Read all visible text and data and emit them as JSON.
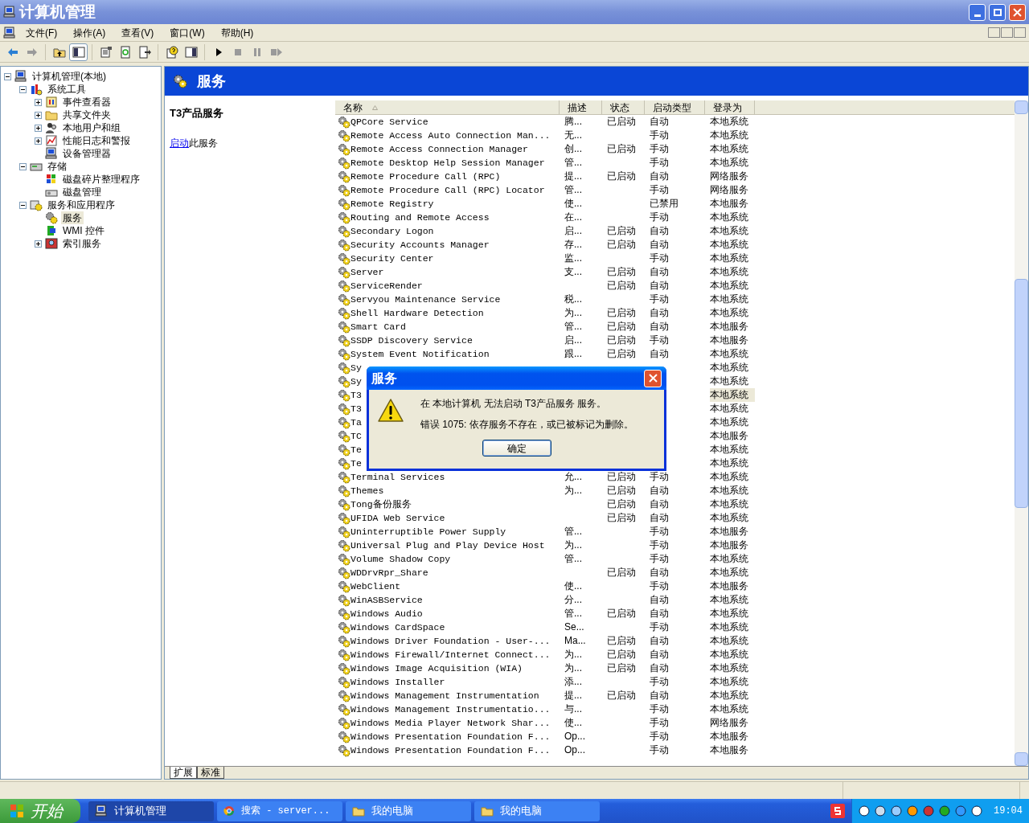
{
  "window": {
    "title": "计算机管理"
  },
  "menu": [
    "文件(F)",
    "操作(A)",
    "查看(V)",
    "窗口(W)",
    "帮助(H)"
  ],
  "toolbar": [
    {
      "kind": "back",
      "pressed": false
    },
    {
      "kind": "forward",
      "pressed": false
    },
    {
      "kind": "up",
      "pressed": false
    },
    {
      "kind": "tree",
      "pressed": true
    },
    {
      "kind": "properties",
      "pressed": false
    },
    {
      "kind": "refresh",
      "pressed": false
    },
    {
      "kind": "export",
      "pressed": false
    },
    {
      "kind": "help",
      "pressed": false
    },
    {
      "kind": "pane",
      "pressed": false
    },
    {
      "kind": "play",
      "pressed": false
    },
    {
      "kind": "stop",
      "pressed": false
    },
    {
      "kind": "pause",
      "pressed": false
    },
    {
      "kind": "restart",
      "pressed": false
    }
  ],
  "tree": [
    {
      "label": "计算机管理(本地)",
      "expanded": true,
      "selected": false,
      "children": [
        {
          "label": "系统工具",
          "expanded": true,
          "selected": false,
          "children": [
            {
              "label": "事件查看器",
              "expanded": false,
              "selected": false
            },
            {
              "label": "共享文件夹",
              "expanded": false,
              "selected": false
            },
            {
              "label": "本地用户和组",
              "expanded": false,
              "selected": false
            },
            {
              "label": "性能日志和警报",
              "expanded": false,
              "selected": false
            },
            {
              "label": "设备管理器",
              "selected": false
            }
          ]
        },
        {
          "label": "存储",
          "expanded": true,
          "selected": false,
          "children": [
            {
              "label": "磁盘碎片整理程序",
              "selected": false
            },
            {
              "label": "磁盘管理",
              "selected": false
            }
          ]
        },
        {
          "label": "服务和应用程序",
          "expanded": true,
          "selected": false,
          "children": [
            {
              "label": "服务",
              "selected": true
            },
            {
              "label": "WMI 控件",
              "selected": false
            },
            {
              "label": "索引服务",
              "expanded": false,
              "selected": false
            }
          ]
        }
      ]
    }
  ],
  "header": {
    "title": "服务"
  },
  "details": {
    "title": "T3产品服务",
    "link": "启动",
    "text": "此服务"
  },
  "table": {
    "columns": [
      {
        "label": "名称",
        "sorted": true
      },
      {
        "label": "描述",
        "sorted": false
      },
      {
        "label": "状态",
        "sorted": false
      },
      {
        "label": "启动类型",
        "sorted": false
      },
      {
        "label": "登录为",
        "sorted": false
      }
    ],
    "rows": [
      {
        "name": "QPCore Service",
        "description": "腾...",
        "status": "已启动",
        "startup_type": "自动",
        "log_on_as": "本地系统",
        "selected": false
      },
      {
        "name": "Remote Access Auto Connection Man...",
        "description": "无...",
        "status": "",
        "startup_type": "手动",
        "log_on_as": "本地系统",
        "selected": false
      },
      {
        "name": "Remote Access Connection Manager",
        "description": "创...",
        "status": "已启动",
        "startup_type": "手动",
        "log_on_as": "本地系统",
        "selected": false
      },
      {
        "name": "Remote Desktop Help Session Manager",
        "description": "管...",
        "status": "",
        "startup_type": "手动",
        "log_on_as": "本地系统",
        "selected": false
      },
      {
        "name": "Remote Procedure Call (RPC)",
        "description": "提...",
        "status": "已启动",
        "startup_type": "自动",
        "log_on_as": "网络服务",
        "selected": false
      },
      {
        "name": "Remote Procedure Call (RPC) Locator",
        "description": "管...",
        "status": "",
        "startup_type": "手动",
        "log_on_as": "网络服务",
        "selected": false
      },
      {
        "name": "Remote Registry",
        "description": "使...",
        "status": "",
        "startup_type": "已禁用",
        "log_on_as": "本地服务",
        "selected": false
      },
      {
        "name": "Routing and Remote Access",
        "description": "在...",
        "status": "",
        "startup_type": "手动",
        "log_on_as": "本地系统",
        "selected": false
      },
      {
        "name": "Secondary Logon",
        "description": "启...",
        "status": "已启动",
        "startup_type": "自动",
        "log_on_as": "本地系统",
        "selected": false
      },
      {
        "name": "Security Accounts Manager",
        "description": "存...",
        "status": "已启动",
        "startup_type": "自动",
        "log_on_as": "本地系统",
        "selected": false
      },
      {
        "name": "Security Center",
        "description": "监...",
        "status": "",
        "startup_type": "手动",
        "log_on_as": "本地系统",
        "selected": false
      },
      {
        "name": "Server",
        "description": "支...",
        "status": "已启动",
        "startup_type": "自动",
        "log_on_as": "本地系统",
        "selected": false
      },
      {
        "name": "ServiceRender",
        "description": "",
        "status": "已启动",
        "startup_type": "自动",
        "log_on_as": "本地系统",
        "selected": false
      },
      {
        "name": "Servyou Maintenance Service",
        "description": "税...",
        "status": "",
        "startup_type": "手动",
        "log_on_as": "本地系统",
        "selected": false
      },
      {
        "name": "Shell Hardware Detection",
        "description": "为...",
        "status": "已启动",
        "startup_type": "自动",
        "log_on_as": "本地系统",
        "selected": false
      },
      {
        "name": "Smart Card",
        "description": "管...",
        "status": "已启动",
        "startup_type": "自动",
        "log_on_as": "本地服务",
        "selected": false
      },
      {
        "name": "SSDP Discovery Service",
        "description": "启...",
        "status": "已启动",
        "startup_type": "手动",
        "log_on_as": "本地服务",
        "selected": false
      },
      {
        "name": "System Event Notification",
        "description": "跟...",
        "status": "已启动",
        "startup_type": "自动",
        "log_on_as": "本地系统",
        "selected": false
      },
      {
        "name": "Sy",
        "description": "",
        "status": "",
        "startup_type": "",
        "log_on_as": "本地系统",
        "selected": false
      },
      {
        "name": "Sy",
        "description": "",
        "status": "",
        "startup_type": "",
        "log_on_as": "本地系统",
        "selected": false
      },
      {
        "name": "T3",
        "description": "",
        "status": "",
        "startup_type": "",
        "log_on_as": "本地系统",
        "selected": true
      },
      {
        "name": "T3",
        "description": "",
        "status": "",
        "startup_type": "",
        "log_on_as": "本地系统",
        "selected": false
      },
      {
        "name": "Ta",
        "description": "",
        "status": "",
        "startup_type": "",
        "log_on_as": "本地系统",
        "selected": false
      },
      {
        "name": "TC",
        "description": "",
        "status": "",
        "startup_type": "",
        "log_on_as": "本地服务",
        "selected": false
      },
      {
        "name": "Te",
        "description": "",
        "status": "",
        "startup_type": "",
        "log_on_as": "本地系统",
        "selected": false
      },
      {
        "name": "Te",
        "description": "",
        "status": "",
        "startup_type": "",
        "log_on_as": "本地系统",
        "selected": false
      },
      {
        "name": "Terminal Services",
        "description": "允...",
        "status": "已启动",
        "startup_type": "手动",
        "log_on_as": "本地系统",
        "selected": false
      },
      {
        "name": "Themes",
        "description": "为...",
        "status": "已启动",
        "startup_type": "自动",
        "log_on_as": "本地系统",
        "selected": false
      },
      {
        "name": "Tong备份服务",
        "description": "",
        "status": "已启动",
        "startup_type": "自动",
        "log_on_as": "本地系统",
        "selected": false
      },
      {
        "name": "UFIDA Web Service",
        "description": "",
        "status": "已启动",
        "startup_type": "自动",
        "log_on_as": "本地系统",
        "selected": false
      },
      {
        "name": "Uninterruptible Power Supply",
        "description": "管...",
        "status": "",
        "startup_type": "手动",
        "log_on_as": "本地服务",
        "selected": false
      },
      {
        "name": "Universal Plug and Play Device Host",
        "description": "为...",
        "status": "",
        "startup_type": "手动",
        "log_on_as": "本地服务",
        "selected": false
      },
      {
        "name": "Volume Shadow Copy",
        "description": "管...",
        "status": "",
        "startup_type": "手动",
        "log_on_as": "本地系统",
        "selected": false
      },
      {
        "name": "WDDrvRpr_Share",
        "description": "",
        "status": "已启动",
        "startup_type": "自动",
        "log_on_as": "本地系统",
        "selected": false
      },
      {
        "name": "WebClient",
        "description": "使...",
        "status": "",
        "startup_type": "手动",
        "log_on_as": "本地服务",
        "selected": false
      },
      {
        "name": "WinASBService",
        "description": "分...",
        "status": "",
        "startup_type": "自动",
        "log_on_as": "本地系统",
        "selected": false
      },
      {
        "name": "Windows Audio",
        "description": "管...",
        "status": "已启动",
        "startup_type": "自动",
        "log_on_as": "本地系统",
        "selected": false
      },
      {
        "name": "Windows CardSpace",
        "description": "Se...",
        "status": "",
        "startup_type": "手动",
        "log_on_as": "本地系统",
        "selected": false
      },
      {
        "name": "Windows Driver Foundation - User-...",
        "description": "Ma...",
        "status": "已启动",
        "startup_type": "自动",
        "log_on_as": "本地系统",
        "selected": false
      },
      {
        "name": "Windows Firewall/Internet Connect...",
        "description": "为...",
        "status": "已启动",
        "startup_type": "自动",
        "log_on_as": "本地系统",
        "selected": false
      },
      {
        "name": "Windows Image Acquisition (WIA)",
        "description": "为...",
        "status": "已启动",
        "startup_type": "自动",
        "log_on_as": "本地系统",
        "selected": false
      },
      {
        "name": "Windows Installer",
        "description": "添...",
        "status": "",
        "startup_type": "手动",
        "log_on_as": "本地系统",
        "selected": false
      },
      {
        "name": "Windows Management Instrumentation",
        "description": "提...",
        "status": "已启动",
        "startup_type": "自动",
        "log_on_as": "本地系统",
        "selected": false
      },
      {
        "name": "Windows Management Instrumentatio...",
        "description": "与...",
        "status": "",
        "startup_type": "手动",
        "log_on_as": "本地系统",
        "selected": false
      },
      {
        "name": "Windows Media Player Network Shar...",
        "description": "使...",
        "status": "",
        "startup_type": "手动",
        "log_on_as": "网络服务",
        "selected": false
      },
      {
        "name": "Windows Presentation Foundation F...",
        "description": "Op...",
        "status": "",
        "startup_type": "手动",
        "log_on_as": "本地服务",
        "selected": false
      },
      {
        "name": "Windows Presentation Foundation F...",
        "description": "Op...",
        "status": "",
        "startup_type": "手动",
        "log_on_as": "本地服务",
        "selected": false
      }
    ]
  },
  "view_tabs": [
    {
      "label": "扩展",
      "selected": true
    },
    {
      "label": "标准",
      "selected": false
    }
  ],
  "dialog": {
    "title": "服务",
    "lines": [
      "在 本地计算机 无法启动 T3产品服务 服务。",
      "错误 1075: 依存服务不存在，或已被标记为删除。"
    ],
    "button": "确定"
  },
  "taskbar": {
    "start": "开始",
    "tasks": [
      {
        "label": "计算机管理",
        "selected": true
      },
      {
        "label": "搜索 - server...",
        "selected": false
      },
      {
        "label": "我的电脑",
        "selected": false
      },
      {
        "label": "我的电脑",
        "selected": false
      }
    ],
    "clock": "19:04"
  }
}
